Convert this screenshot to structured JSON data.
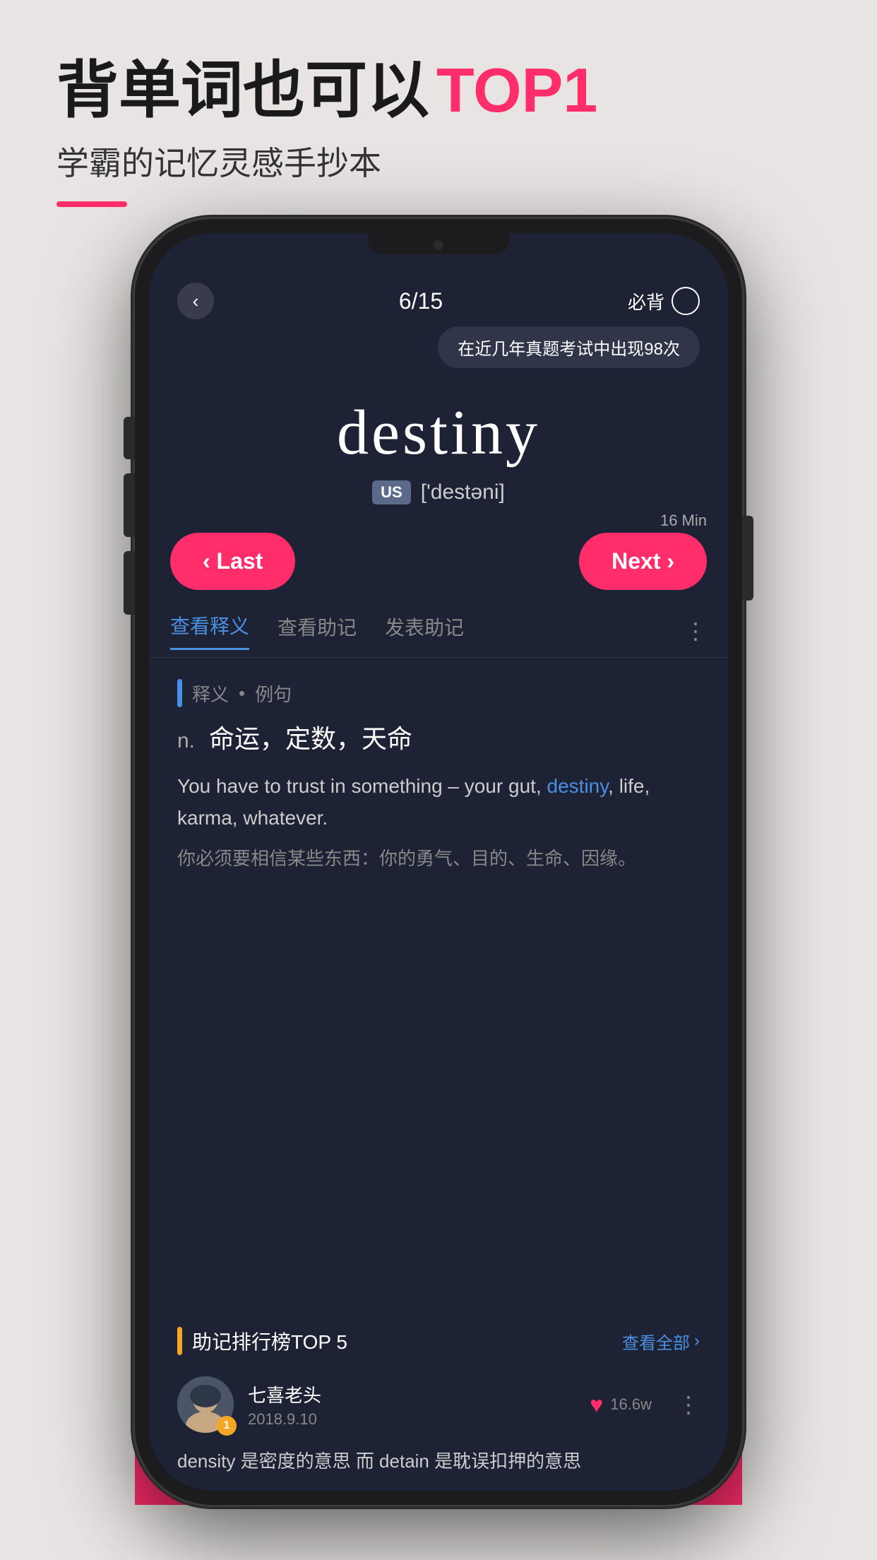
{
  "headline": {
    "part1": "背单词也可以",
    "part2": "TOP1"
  },
  "subtitle": "学霸的记忆灵感手抄本",
  "phone": {
    "header": {
      "back_icon": "‹",
      "progress": "6/15",
      "must_remember": "必背"
    },
    "tooltip": "在近几年真题考试中出现98次",
    "word": {
      "text": "destiny",
      "lang": "US",
      "phonetic": "['destəni]"
    },
    "time_label": "16 Min",
    "nav": {
      "last_label": "‹ Last",
      "next_label": "Next ›"
    },
    "tabs": [
      {
        "label": "查看释义",
        "active": true
      },
      {
        "label": "查看助记",
        "active": false
      },
      {
        "label": "发表助记",
        "active": false
      }
    ],
    "section_definition": {
      "title": "释义",
      "subtitle": "例句",
      "pos": "n.",
      "definition": "命运，定数，天命",
      "example_en": "You have to trust in something – your gut, destiny, life, karma, whatever.",
      "highlight": "destiny",
      "example_cn": "你必须要相信某些东西：你的勇气、目的、生命、因缘。"
    },
    "ranking": {
      "title": "助记排行榜TOP 5",
      "view_all": "查看全部",
      "entries": [
        {
          "username": "七喜老头",
          "date": "2018.9.10",
          "rank": "1",
          "likes": "16.6w",
          "text": "density 是密度的意思 而 detain 是耽误扣押的意思"
        }
      ]
    }
  }
}
